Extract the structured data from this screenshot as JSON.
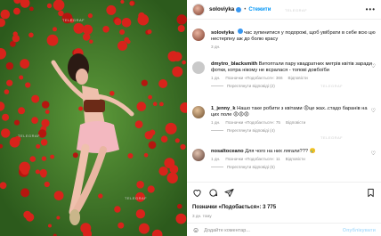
{
  "header": {
    "username": "soloviyka",
    "dot": "•",
    "follow_label": "Стежити",
    "more_label": "•••"
  },
  "watermark": "TELEGRAF",
  "caption": {
    "username": "soloviyka",
    "text": "час зупинитися у подорожі, щоб увібрати в себе всю цю нестерпну аж до болю красу",
    "time": "3 дн."
  },
  "comments": [
    {
      "username": "dmytro_blacksmith",
      "text": "Витоптали пару квадратних метрів квітів заради фотки, котра нікому не всралася - топові довбоїби",
      "time": "1 дн.",
      "likes": "Позначки «Подобається»: 366",
      "reply_label": "Відповісти",
      "replies_label": "Переглянути відповіді (2)"
    },
    {
      "username": "1_jenny_k",
      "text": "Нашо таке робити з квітами 😡це жах..стадо баранів на цих поле 😡😡😡",
      "time": "1 дн.",
      "likes": "Позначки «Подобається»: 75",
      "reply_label": "Відповісти",
      "replies_label": "Переглянути відповіді (4)"
    },
    {
      "username": "nosaltoceano",
      "text": "Для чого на них лягали??? 🥲",
      "time": "1 дн.",
      "likes": "Позначки «Подобається»: 11",
      "reply_label": "Відповісти",
      "replies_label": "Переглянути відповіді (5)"
    }
  ],
  "footer": {
    "likes": "Позначки «Подобається»: 3 775",
    "date": "3 дн. тому",
    "add_comment_placeholder": "Додайте коментар...",
    "post_label": "Опублікувати"
  },
  "colors": {
    "accent": "#0095f6",
    "verified": "#3897f0",
    "poppy_red": "#d8231b",
    "meadow_green": "#3f7a2a"
  }
}
